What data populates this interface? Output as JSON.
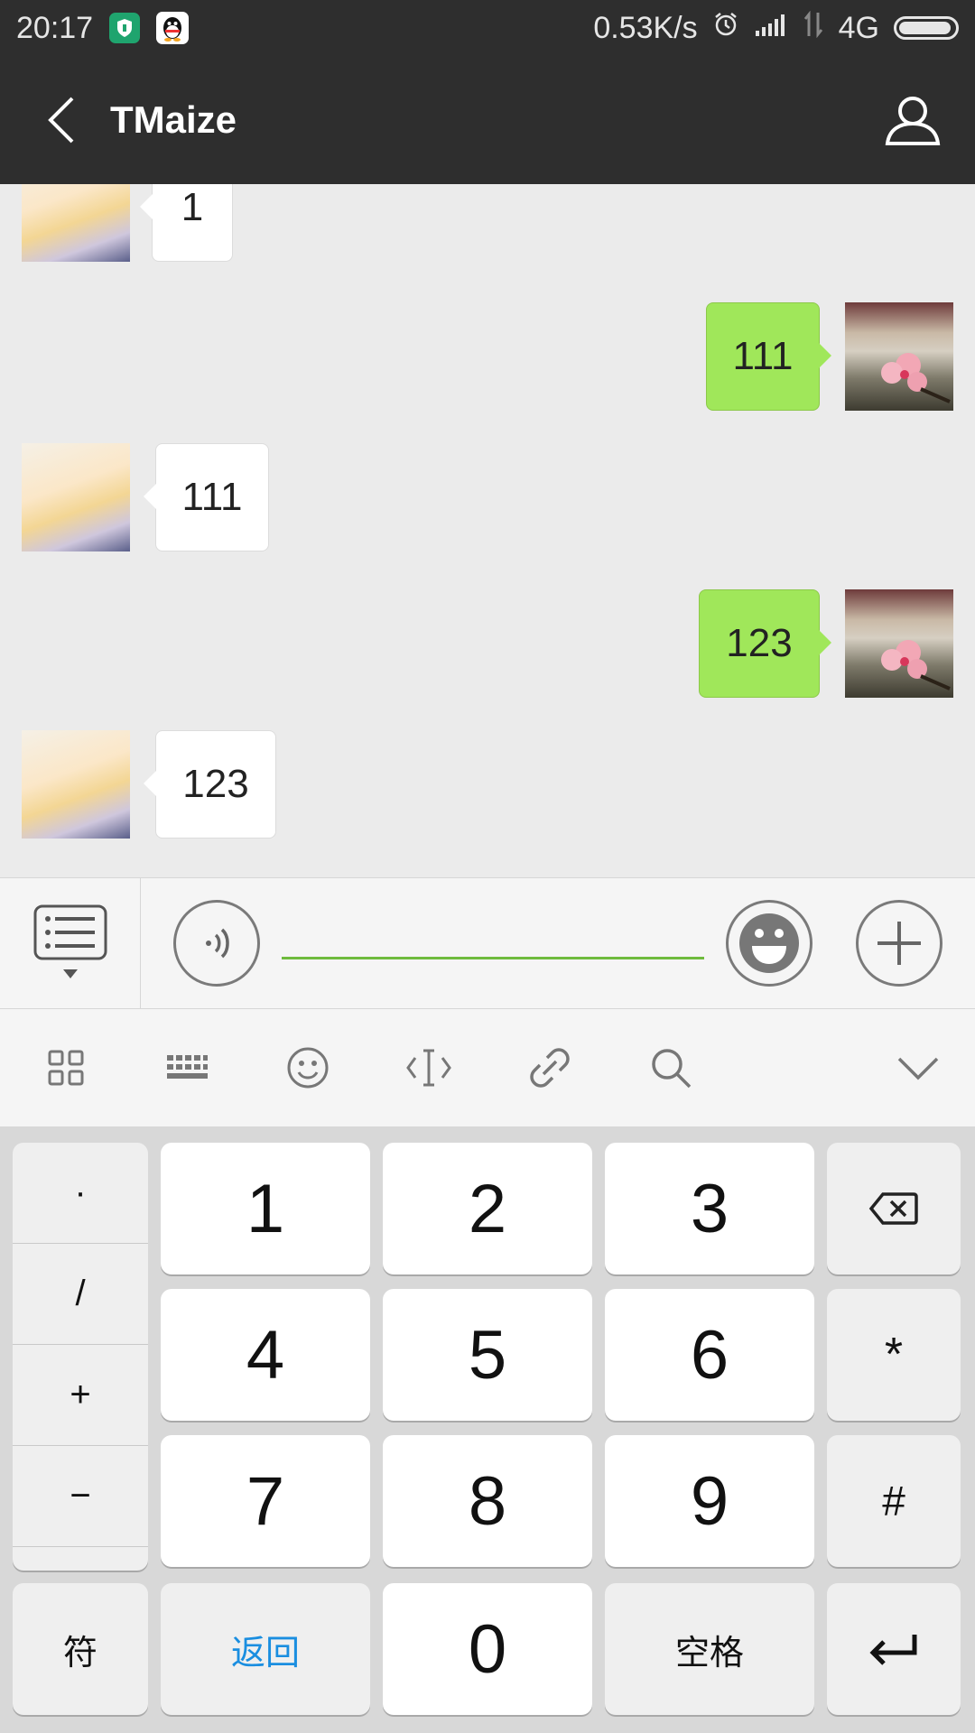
{
  "status_bar": {
    "time": "20:17",
    "net_speed": "0.53K/s",
    "network_type": "4G",
    "battery_level": 0.95
  },
  "header": {
    "title": "TMaize"
  },
  "messages": [
    {
      "from": "other",
      "text": "1"
    },
    {
      "from": "me",
      "text": "111"
    },
    {
      "from": "other",
      "text": "111"
    },
    {
      "from": "me",
      "text": "123"
    },
    {
      "from": "other",
      "text": "123"
    }
  ],
  "input": {
    "value": "",
    "placeholder": ""
  },
  "ime_toolbar": {
    "tools": [
      "grid-icon",
      "keyboard-icon",
      "emoji-icon",
      "cursor-icon",
      "link-icon",
      "search-icon",
      "chevron-down-icon"
    ]
  },
  "keyboard": {
    "symbols": [
      "·",
      "/",
      "+",
      "−"
    ],
    "digits": [
      "1",
      "2",
      "3",
      "4",
      "5",
      "6",
      "7",
      "8",
      "9",
      "0"
    ],
    "star": "*",
    "hash": "#",
    "fu_label": "符",
    "back_label": "返回",
    "space_label": "空格"
  },
  "colors": {
    "header_bg": "#2e2e2e",
    "bubble_out": "#a0e75a",
    "bubble_in": "#ffffff",
    "input_underline": "#6fbb3d",
    "back_key_text": "#1a8ee0"
  }
}
